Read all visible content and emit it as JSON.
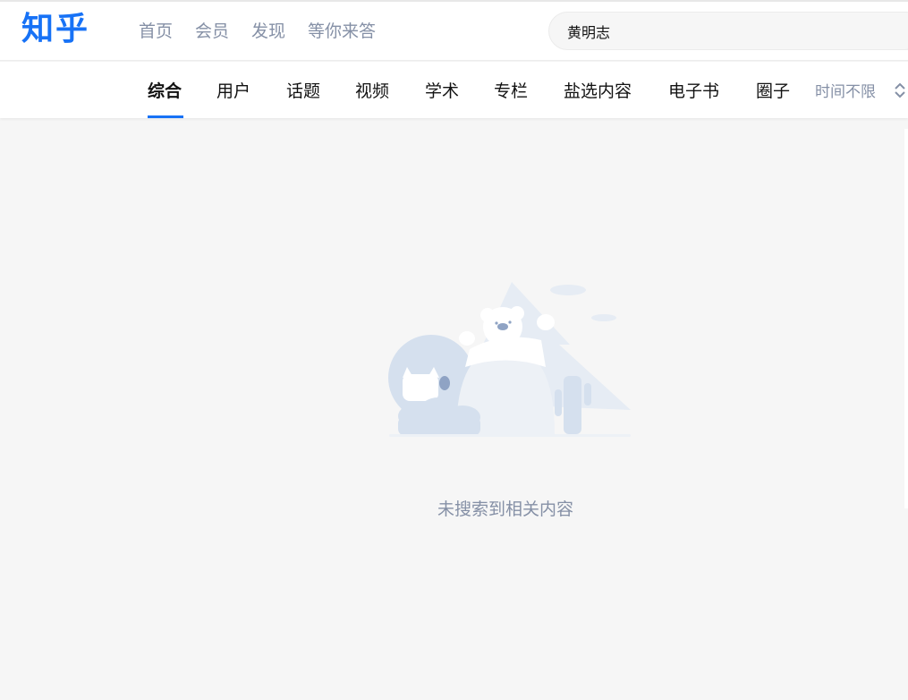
{
  "header": {
    "logo": "知乎",
    "nav": [
      "首页",
      "会员",
      "发现",
      "等你来答"
    ],
    "search_value": "黄明志"
  },
  "tabs": {
    "items": [
      "综合",
      "用户",
      "话题",
      "视频",
      "学术",
      "专栏",
      "盐选内容",
      "电子书",
      "圈子"
    ],
    "active": "综合",
    "time_filter": "时间不限"
  },
  "empty": {
    "message": "未搜索到相关内容"
  },
  "colors": {
    "brand": "#1772f6",
    "muted_text": "#8590a6",
    "page_bg": "#f6f6f6"
  }
}
